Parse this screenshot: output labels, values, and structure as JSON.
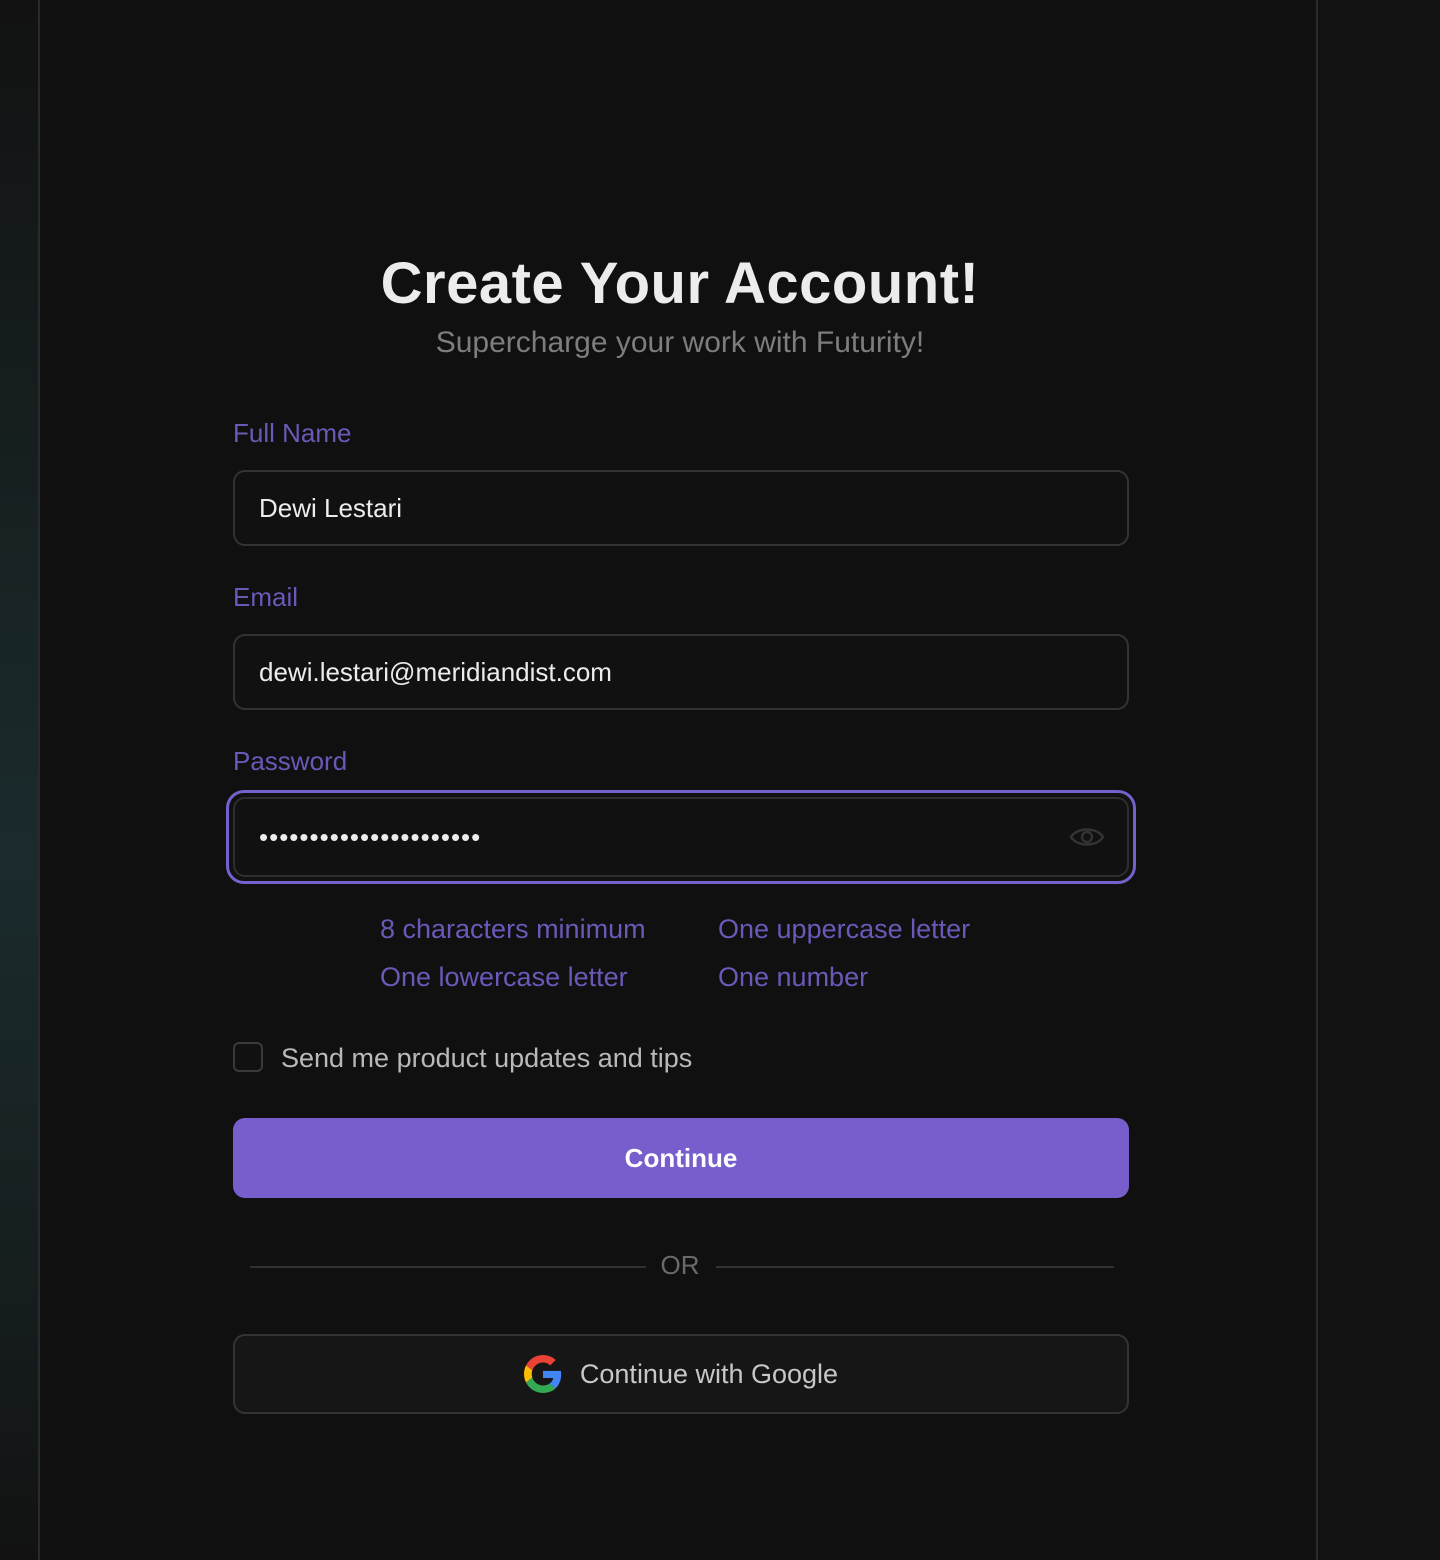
{
  "header": {
    "title": "Create Your Account!",
    "subtitle": "Supercharge your work with Futurity!"
  },
  "form": {
    "full_name": {
      "label": "Full Name",
      "value": "Dewi Lestari"
    },
    "email": {
      "label": "Email",
      "value": "dewi.lestari@meridiandist.com"
    },
    "password": {
      "label": "Password",
      "value": "••••••••••••••••••••••",
      "toggle_icon": "eye-icon"
    },
    "password_rules": [
      "8 characters minimum",
      "One uppercase letter",
      "One lowercase letter",
      "One number"
    ],
    "newsletter": {
      "label": "Send me product updates and tips",
      "checked": false
    },
    "continue_label": "Continue",
    "divider_text": "OR",
    "google_label": "Continue with Google",
    "google_icon": "google-icon"
  },
  "colors": {
    "accent": "#775ecc",
    "label": "#6c58b8",
    "background": "#101010"
  }
}
